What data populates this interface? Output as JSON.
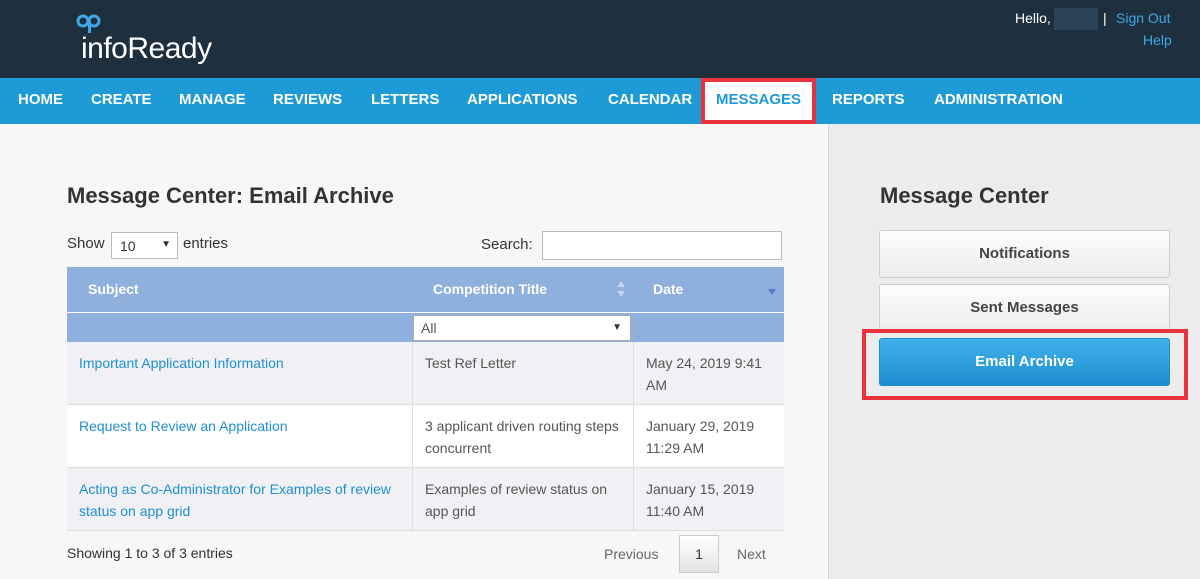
{
  "header": {
    "logo_text": "infoReady",
    "hello": "Hello,",
    "separator": "|",
    "sign_out": "Sign Out",
    "help": "Help"
  },
  "nav": {
    "items": [
      {
        "label": "HOME"
      },
      {
        "label": "CREATE"
      },
      {
        "label": "MANAGE"
      },
      {
        "label": "REVIEWS"
      },
      {
        "label": "LETTERS"
      },
      {
        "label": "APPLICATIONS"
      },
      {
        "label": "CALENDAR"
      },
      {
        "label": "MESSAGES",
        "active": true
      },
      {
        "label": "REPORTS"
      },
      {
        "label": "ADMINISTRATION"
      }
    ]
  },
  "main": {
    "title": "Message Center: Email Archive",
    "show_label": "Show",
    "length_value": "10",
    "entries_label": "entries",
    "search_label": "Search:",
    "search_value": "",
    "columns": [
      "Subject",
      "Competition Title",
      "Date"
    ],
    "filter_value": "All",
    "rows": [
      {
        "subject": "Important Application Information",
        "competition": "Test Ref Letter",
        "date": "May 24, 2019 9:41 AM"
      },
      {
        "subject": "Request to Review an Application",
        "competition": "3 applicant driven routing steps concurrent",
        "date": "January 29, 2019 11:29 AM"
      },
      {
        "subject": "Acting as Co-Administrator for Examples of review status on app grid",
        "competition": "Examples of review status on app grid",
        "date": "January 15, 2019 11:40 AM"
      }
    ],
    "info": "Showing 1 to 3 of 3 entries",
    "pagination": {
      "previous": "Previous",
      "page": "1",
      "next": "Next"
    }
  },
  "sidebar": {
    "title": "Message Center",
    "buttons": [
      {
        "label": "Notifications"
      },
      {
        "label": "Sent Messages"
      },
      {
        "label": "Email Archive",
        "active": true
      }
    ]
  },
  "colors": {
    "header_bg": "#1e2f3d",
    "nav_bg": "#1e9bd7",
    "highlight": "#e8323c",
    "table_header": "#8fb0dc",
    "link": "#1e8fcf"
  }
}
